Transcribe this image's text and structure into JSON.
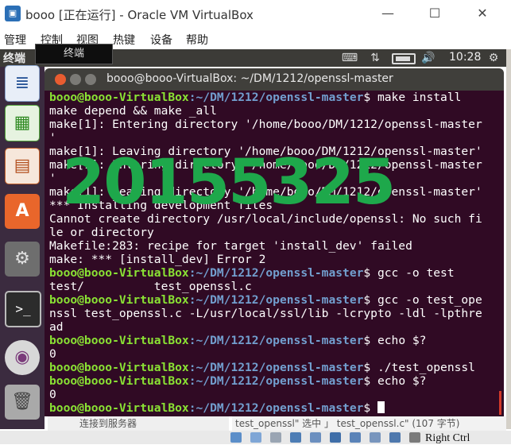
{
  "window": {
    "title": "booo [正在运行] - Oracle VM VirtualBox",
    "controls": {
      "minimize": "—",
      "maximize": "☐",
      "close": "✕"
    }
  },
  "vbox_menu": [
    "管理",
    "控制",
    "视图",
    "热键",
    "设备",
    "帮助"
  ],
  "ubuntu_panel": {
    "app_title": "终端",
    "tooltip": "终端",
    "clock": "10:28"
  },
  "launcher": [
    {
      "name": "libreoffice-writer",
      "glyph": "≣"
    },
    {
      "name": "libreoffice-calc",
      "glyph": "▦"
    },
    {
      "name": "libreoffice-impress",
      "glyph": "▤"
    },
    {
      "name": "ubuntu-software",
      "glyph": "A"
    },
    {
      "name": "system-settings",
      "glyph": "⚙"
    },
    {
      "name": "terminal",
      "glyph": ">_"
    },
    {
      "name": "dvd",
      "glyph": "◉"
    },
    {
      "name": "trash",
      "glyph": "🗑"
    }
  ],
  "terminal": {
    "title": "booo@booo-VirtualBox: ~/DM/1212/openssl-master",
    "lines": [
      {
        "user": "booo@booo-VirtualBox",
        "path": ":~/DM/1212/openssl-master",
        "cmd": "$ make install"
      },
      {
        "text": "make depend && make _all"
      },
      {
        "text": "make[1]: Entering directory '/home/booo/DM/1212/openssl-master"
      },
      {
        "text": "'"
      },
      {
        "text": "make[1]: Leaving directory '/home/booo/DM/1212/openssl-master'"
      },
      {
        "text": "make[1]: Entering directory '/home/booo/DM/1212/openssl-master"
      },
      {
        "text": "'"
      },
      {
        "text": "make[1]: Leaving directory '/home/booo/DM/1212/openssl-master'"
      },
      {
        "text": "*** Installing development files"
      },
      {
        "text": "Cannot create directory /usr/local/include/openssl: No such fi"
      },
      {
        "text": "le or directory"
      },
      {
        "text": "Makefile:283: recipe for target 'install_dev' failed"
      },
      {
        "text": "make: *** [install_dev] Error 2"
      },
      {
        "user": "booo@booo-VirtualBox",
        "path": ":~/DM/1212/openssl-master",
        "cmd": "$ gcc -o test"
      },
      {
        "text": "test/          test_openssl.c"
      },
      {
        "user": "booo@booo-VirtualBox",
        "path": ":~/DM/1212/openssl-master",
        "cmd": "$ gcc -o test_ope"
      },
      {
        "text": "nssl test_openssl.c -L/usr/local/ssl/lib -lcrypto -ldl -lpthre"
      },
      {
        "text": "ad"
      },
      {
        "user": "booo@booo-VirtualBox",
        "path": ":~/DM/1212/openssl-master",
        "cmd": "$ echo $?"
      },
      {
        "text": "0"
      },
      {
        "user": "booo@booo-VirtualBox",
        "path": ":~/DM/1212/openssl-master",
        "cmd": "$ ./test_openssl"
      },
      {
        "user": "booo@booo-VirtualBox",
        "path": ":~/DM/1212/openssl-master",
        "cmd": "$ echo $?"
      },
      {
        "text": "0"
      },
      {
        "user": "booo@booo-VirtualBox",
        "path": ":~/DM/1212/openssl-master",
        "cmd": "$ ",
        "cursor": true
      }
    ],
    "colors": {
      "background": "#300a24",
      "user": "#8ae234",
      "path": "#729fcf",
      "text": "#ffffff"
    }
  },
  "watermark": {
    "text": "20155325",
    "color": "#1ea84b"
  },
  "background_windows": {
    "left_text": "连接到服务器",
    "right_text": "test_openssl\" 选中 」 test_openssl.c\" (107 字节)"
  },
  "vbox_status": {
    "host_key": "Right Ctrl"
  }
}
